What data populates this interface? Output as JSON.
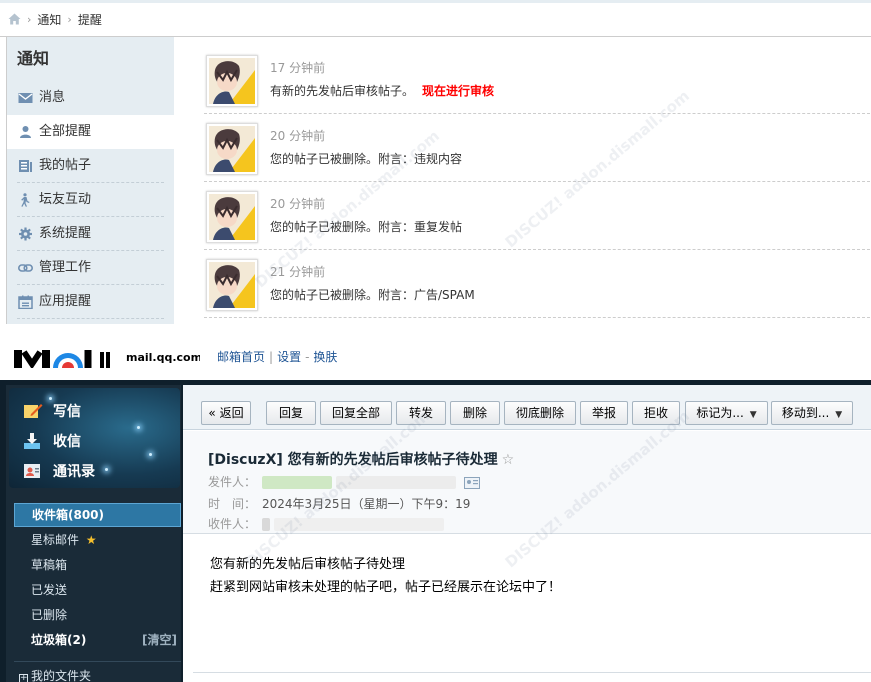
{
  "breadcrumb": {
    "items": [
      "通知",
      "提醒"
    ]
  },
  "notice_sidebar": {
    "title": "通知",
    "items": [
      {
        "label": "消息",
        "icon": "mail-icon"
      },
      {
        "label": "全部提醒",
        "icon": "user-icon"
      },
      {
        "label": "我的帖子",
        "icon": "post-icon"
      },
      {
        "label": "坛友互动",
        "icon": "walker-icon"
      },
      {
        "label": "系统提醒",
        "icon": "gear-icon"
      },
      {
        "label": "管理工作",
        "icon": "link-icon"
      },
      {
        "label": "应用提醒",
        "icon": "calendar-icon"
      }
    ]
  },
  "notices": [
    {
      "time": "17 分钟前",
      "text": "有新的先发帖后审核帖子。",
      "link": "现在进行审核"
    },
    {
      "time": "20 分钟前",
      "text": "您的帖子已被删除。附言：违规内容"
    },
    {
      "time": "20 分钟前",
      "text": "您的帖子已被删除。附言：重复发帖"
    },
    {
      "time": "21 分钟前",
      "text": "您的帖子已被删除。附言：广告/SPAM"
    }
  ],
  "mail_header": {
    "domain": "mail.qq.com",
    "nav": [
      "邮箱首页",
      "设置",
      "换肤"
    ]
  },
  "mail_actions": [
    {
      "label": "写信",
      "icon": "compose-icon"
    },
    {
      "label": "收信",
      "icon": "download-icon"
    },
    {
      "label": "通讯录",
      "icon": "contacts-icon"
    }
  ],
  "mail_folders": {
    "inbox": "收件箱(800)",
    "starred": "星标邮件",
    "drafts": "草稿箱",
    "sent": "已发送",
    "deleted": "已删除",
    "spam": "垃圾箱(2)",
    "spam_clear": "[清空]",
    "my_folders": "我的文件夹"
  },
  "toolbar": {
    "buttons": [
      "« 返回",
      "回复",
      "回复全部",
      "转发",
      "删除",
      "彻底删除",
      "举报",
      "拒收",
      "标记为...",
      "移动到..."
    ]
  },
  "message": {
    "subject": "[DiscuzX] 您有新的先发帖后审核帖子待处理",
    "from_label": "发件人：",
    "time_label": "时　间：",
    "time_value": "2024年3月25日（星期一）下午9：19",
    "to_label": "收件人：",
    "body_line1": "您有新的先发帖后审核帖子待处理",
    "body_line2": "赶紧到网站审核未处理的帖子吧，帖子已经展示在论坛中了！"
  },
  "colors": {
    "link_red": "#ff0000",
    "nav_blue": "#1e5494",
    "mail_dark": "#0f1f2b",
    "folder_active": "#2d77a4",
    "sidebar_bg": "#e5edf2"
  }
}
